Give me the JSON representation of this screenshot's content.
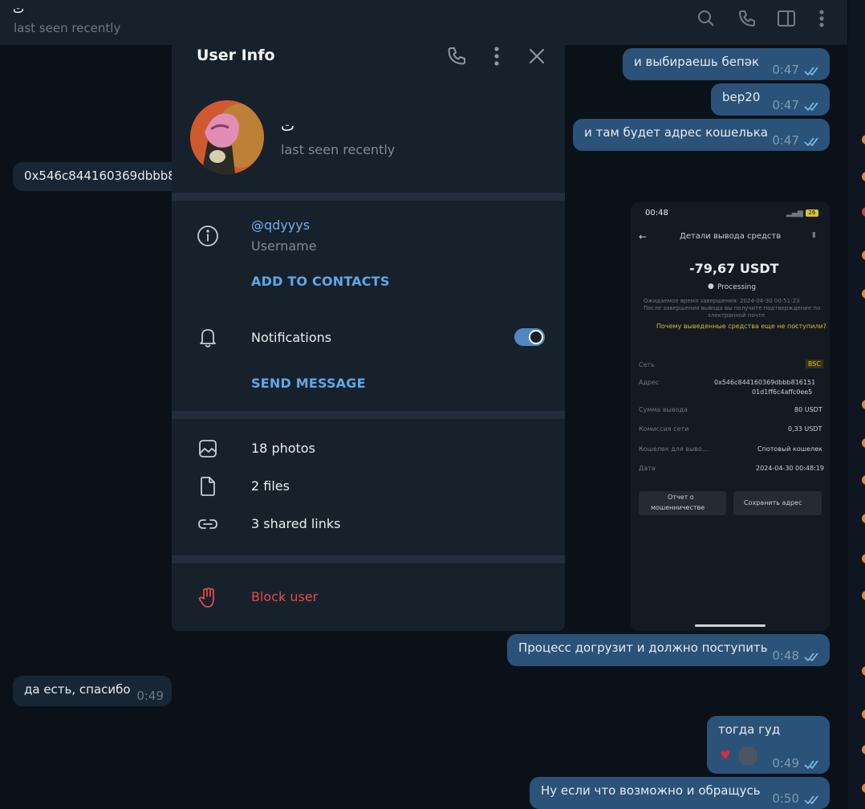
{
  "chat": {
    "title": "ت",
    "status": "last seen recently",
    "header_icons": [
      "search-icon",
      "phone-icon",
      "sidebar-toggle-icon",
      "more-vertical-icon"
    ]
  },
  "messages": [
    {
      "dir": "out",
      "text": "и выбираешь бепәк",
      "time": "0:47"
    },
    {
      "dir": "out",
      "text": "bep20",
      "time": "0:47"
    },
    {
      "dir": "out",
      "text": "и там будет адрес кошелька",
      "time": "0:47"
    },
    {
      "dir": "in",
      "text": "0x546c844160369dbbb8"
    },
    {
      "dir": "out",
      "text": "Процесс догрузит и должно поступить",
      "time": "0:48"
    },
    {
      "dir": "in",
      "text": "да есть, спасибо",
      "time": "0:49"
    },
    {
      "dir": "out",
      "text": "тогда гуд",
      "time": "0:49"
    },
    {
      "dir": "out",
      "text": "Ну если что возможно и обращусь",
      "time": "0:50"
    }
  ],
  "media": {
    "clock": "00:48",
    "battery": "26",
    "screen_title": "Детали вывода средств",
    "amount": "-79,67 USDT",
    "state": "Processing",
    "note1": "Ожидаемое время завершения: 2024-04-30 00:51:23",
    "note2": "После завершения вывода вы получите подтверждение по",
    "note3": "электронной почте",
    "help_link": "Почему выведенные средства еще не поступили?",
    "rows": [
      {
        "k": "Сеть",
        "v": "BSC"
      },
      {
        "k": "Адрес",
        "v": "0x546c844160369dbbb816151"
      },
      {
        "k": "",
        "v": "01d1ff6c4affc0ee5"
      },
      {
        "k": "Сумма вывода",
        "v": "80 USDT"
      },
      {
        "k": "Комиссия сети",
        "v": "0,33 USDT"
      },
      {
        "k": "Кошелек для выво...",
        "v": "Спотовый кошелек"
      },
      {
        "k": "Дата",
        "v": "2024-04-30 00:48:19"
      }
    ],
    "btn_report_1": "Отчет о",
    "btn_report_2": "мошенничестве",
    "btn_save": "Сохранить адрес"
  },
  "modal": {
    "title": "User Info",
    "name": "ت",
    "status": "last seen recently",
    "username": "@qdyyys",
    "username_label": "Username",
    "add_contacts": "ADD TO CONTACTS",
    "notifications": "Notifications",
    "notifications_on": true,
    "send_message": "SEND MESSAGE",
    "photos": "18 photos",
    "files": "2 files",
    "links": "3 shared links",
    "block": "Block user"
  },
  "colors": {
    "accent": "#5288c1",
    "link": "#6ab2f2",
    "danger": "#e5484d",
    "outgoing_bubble": "#2b5278",
    "incoming_bubble": "#182533"
  }
}
